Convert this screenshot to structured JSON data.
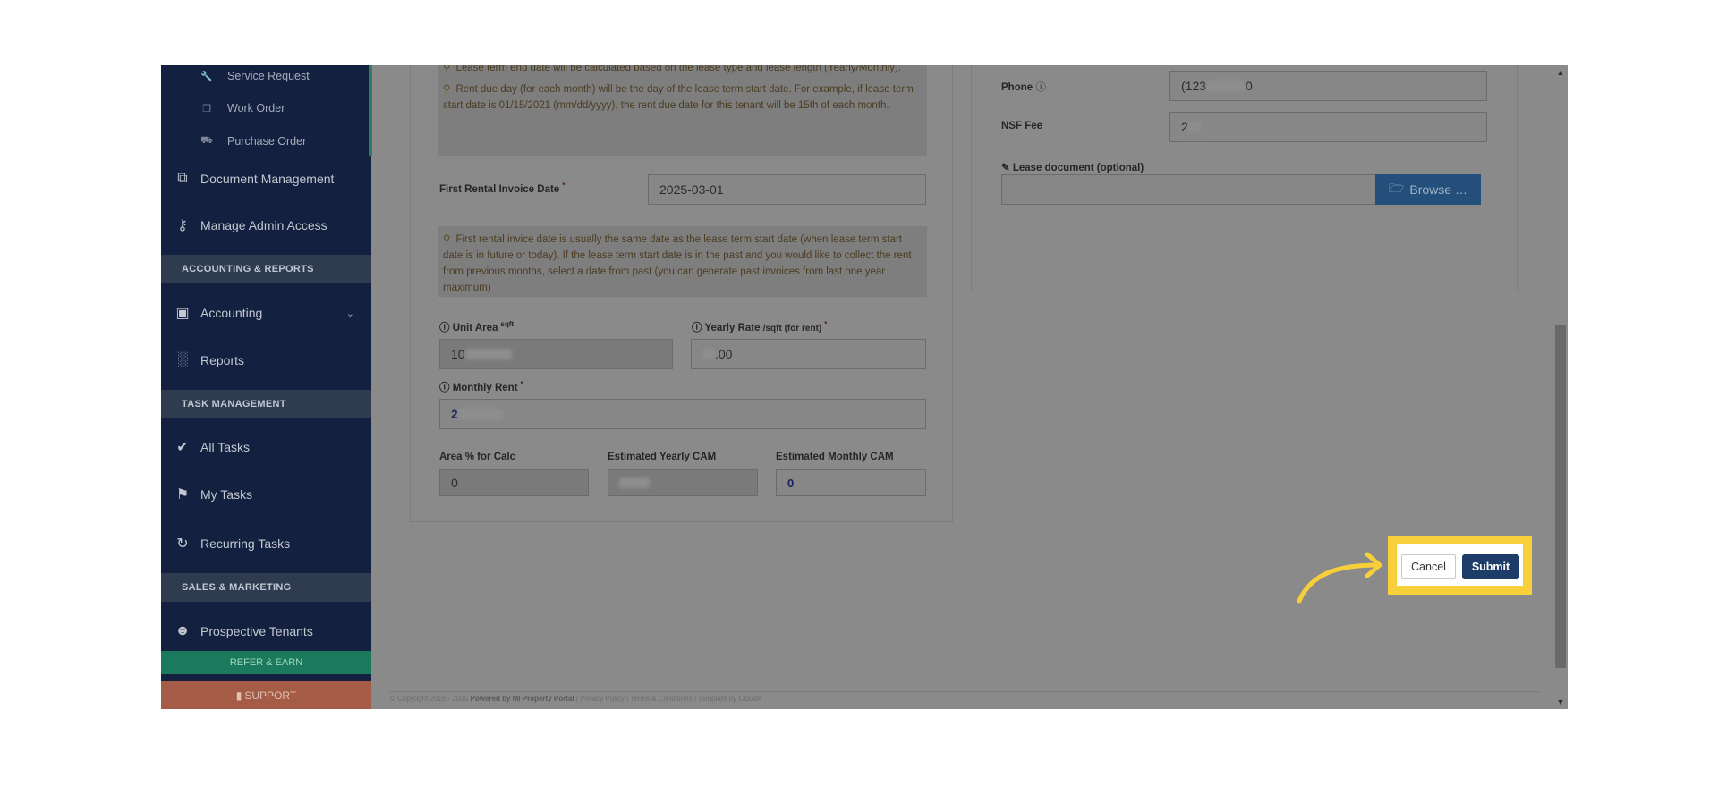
{
  "sidebar": {
    "sub_items": [
      {
        "label": "Service Request",
        "icon": "wrench-icon"
      },
      {
        "label": "Work Order",
        "icon": "copy-icon"
      },
      {
        "label": "Purchase Order",
        "icon": "truck-icon"
      }
    ],
    "document_management": "Document Management",
    "manage_admin_access": "Manage Admin Access",
    "section_accounting": "ACCOUNTING & REPORTS",
    "accounting": "Accounting",
    "reports": "Reports",
    "section_tasks": "TASK MANAGEMENT",
    "all_tasks": "All Tasks",
    "my_tasks": "My Tasks",
    "recurring_tasks": "Recurring Tasks",
    "section_sales": "SALES & MARKETING",
    "prospective_tenants": "Prospective Tenants",
    "refer_earn": "REFER & EARN",
    "support": "SUPPORT"
  },
  "form": {
    "note_lease_end": "Lease term end date will be calculated based on the lease type and lease length (Yearly/Monthly).",
    "note_rent_due": "Rent due day (for each month) will be the day of the lease term start date. For example, if lease term start date is 01/15/2021 (mm/dd/yyyy), the rent due date for this tenant will be 15th of each month.",
    "first_invoice_label": "First Rental Invoice Date",
    "first_invoice_value": "2025-03-01",
    "note_first_invoice": "First rental invice date is usually the same date as the lease term start date (when lease term start date is in future or today). If the lease term start date is in the past and you would like to collect the rent from previous months, select a date from past (you can generate past invoices from last one year maximum)",
    "unit_area_label": "Unit Area",
    "unit_area_unit": "sqft",
    "unit_area_value": "10",
    "yearly_rate_label": "Yearly Rate",
    "yearly_rate_unit": "/sqft (for rent)",
    "yearly_rate_value": ".00",
    "monthly_rent_label": "Monthly Rent",
    "monthly_rent_value": "2",
    "area_pct_label": "Area % for Calc",
    "area_pct_value": "0",
    "est_yearly_cam_label": "Estimated Yearly CAM",
    "est_monthly_cam_label": "Estimated Monthly CAM",
    "est_monthly_cam_value": "0",
    "required_mark": "*",
    "phone_label": "Phone",
    "phone_prefix": "(123",
    "phone_suffix": "0",
    "nsf_label": "NSF Fee",
    "nsf_value": "2",
    "lease_doc_label": "Lease document (optional)",
    "browse_label": "Browse …"
  },
  "actions": {
    "cancel": "Cancel",
    "submit": "Submit"
  },
  "footer": {
    "copyright": "© Copyright 2016 - 2025",
    "powered": "Powered by MI Property Portal",
    "links": "| Privacy Policy | Terms & Conditions |",
    "credit": "Template by Cloudit"
  },
  "colors": {
    "sidebar_bg": "#13203f",
    "highlight": "#f6cf3a",
    "submit_bg": "#1d3c68"
  }
}
